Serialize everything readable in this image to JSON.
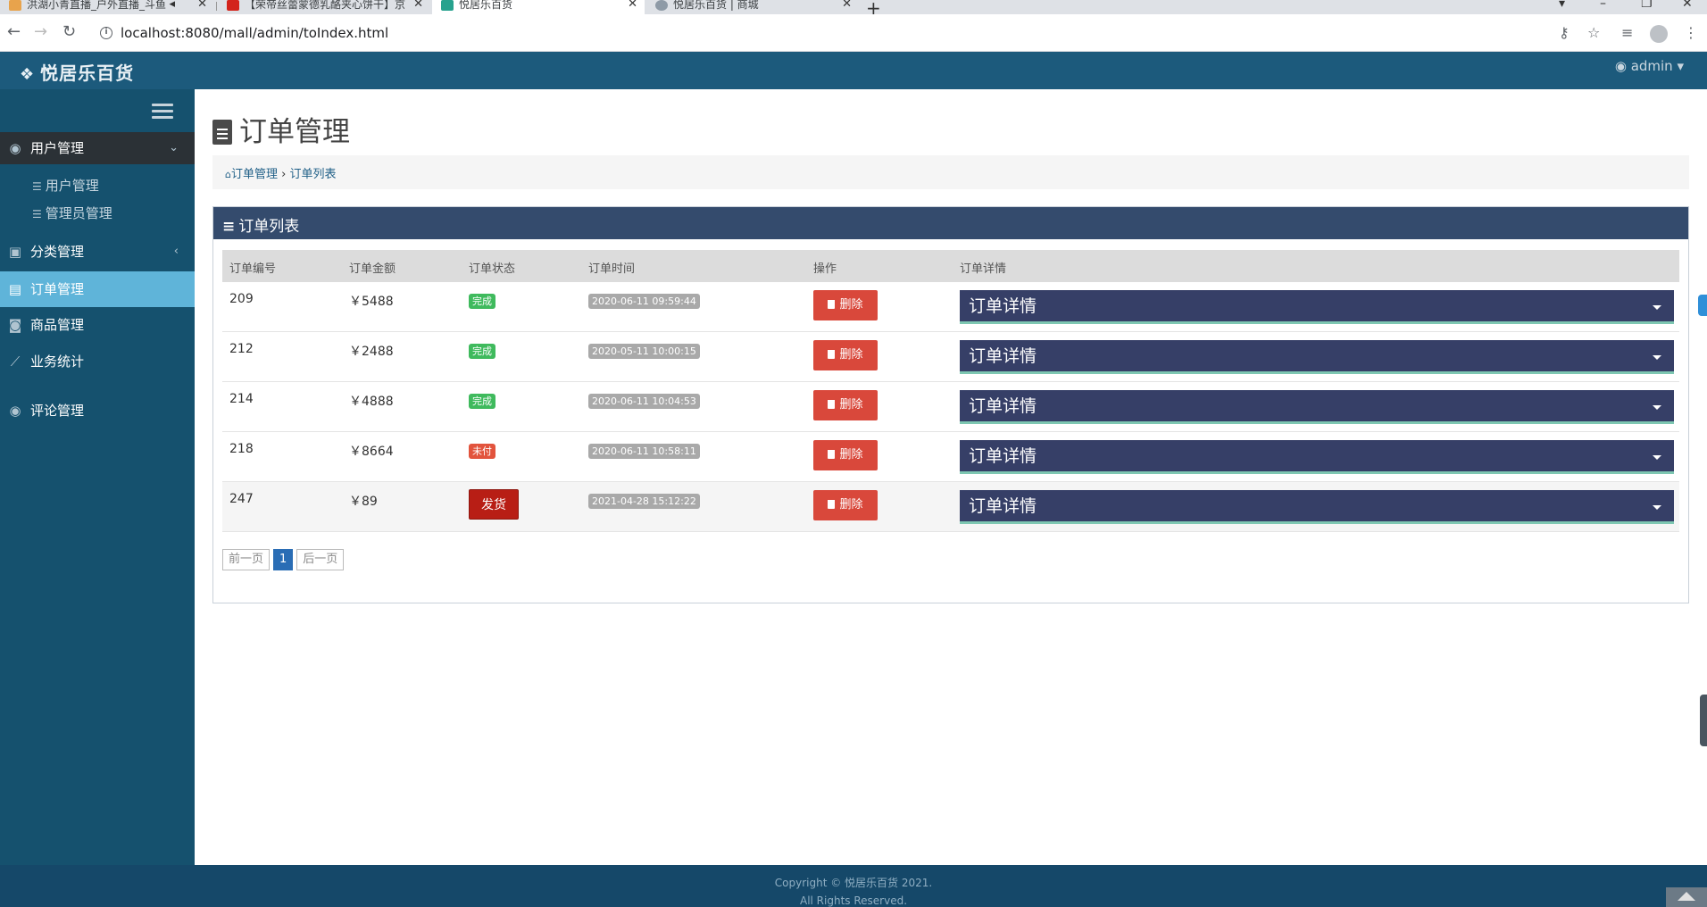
{
  "browser": {
    "tabs": [
      {
        "title": "洪湖小青直播_户外直播_斗鱼"
      },
      {
        "title": "【荣帝丝蕾蒙德乳酪夹心饼干】京"
      },
      {
        "title": "悦居乐百货"
      },
      {
        "title": "悦居乐百货 | 商城"
      }
    ],
    "url": "localhost:8080/mall/admin/toIndex.html"
  },
  "header": {
    "brand": "悦居乐百货",
    "user": "admin"
  },
  "sidebar": {
    "groups": [
      {
        "label": "用户管理",
        "icon": "user-circle-icon"
      },
      {
        "label": "分类管理",
        "icon": "image-icon"
      },
      {
        "label": "订单管理",
        "icon": "file-icon"
      },
      {
        "label": "商品管理",
        "icon": "bag-icon"
      },
      {
        "label": "业务统计",
        "icon": "line-chart-icon"
      },
      {
        "label": "评论管理",
        "icon": "user-circle-icon"
      }
    ],
    "sub_items": [
      {
        "label": "用户管理"
      },
      {
        "label": "管理员管理"
      }
    ]
  },
  "page": {
    "title": "订单管理",
    "breadcrumb": {
      "home": "订单管理",
      "sep": "›",
      "current": "订单列表"
    },
    "panel_title": "订单列表"
  },
  "table": {
    "headers": [
      "订单编号",
      "订单金额",
      "订单状态",
      "订单时间",
      "操作",
      "订单详情"
    ],
    "rows": [
      {
        "id": "209",
        "amount": "￥5488",
        "status": "完成",
        "time": "2020-06-11 09:59:44",
        "action": "删除",
        "detail": "订单详情"
      },
      {
        "id": "212",
        "amount": "￥2488",
        "status": "完成",
        "time": "2020-05-11 10:00:15",
        "action": "删除",
        "detail": "订单详情"
      },
      {
        "id": "214",
        "amount": "￥4888",
        "status": "完成",
        "time": "2020-06-11 10:04:53",
        "action": "删除",
        "detail": "订单详情"
      },
      {
        "id": "218",
        "amount": "￥8664",
        "status": "未付",
        "time": "2020-06-11 10:58:11",
        "action": "删除",
        "detail": "订单详情"
      },
      {
        "id": "247",
        "amount": "￥89",
        "status": "发货",
        "time": "2021-04-28 15:12:22",
        "action": "删除",
        "detail": "订单详情"
      }
    ]
  },
  "pager": {
    "prev": "前一页",
    "current": "1",
    "next": "后一页"
  },
  "footer": {
    "line1": "Copyright © 悦居乐百货 2021.",
    "line2": "All Rights Reserved."
  },
  "colors": {
    "header": "#1c5a7c",
    "sidebar": "#15516e",
    "active": "#5fb4d9",
    "panel_head": "#344b6d",
    "detail": "#363f67"
  }
}
